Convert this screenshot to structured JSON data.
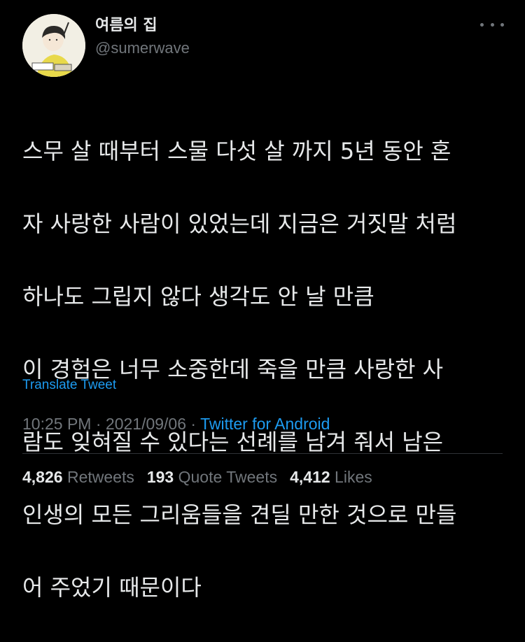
{
  "author": {
    "display_name": "여름의 집",
    "handle": "@sumerwave"
  },
  "tweet": {
    "lines": [
      "스무 살 때부터 스물 다섯 살 까지 5년 동안 혼",
      "자 사랑한 사람이 있었는데 지금은 거짓말 처럼",
      "하나도 그립지 않다 생각도 안 날 만큼",
      "이 경험은 너무 소중한데 죽을 만큼 사랑한 사",
      "람도 잊혀질 수 있다는 선례를 남겨 줘서 남은",
      "인생의 모든 그리움들을 견딜 만한 것으로 만들",
      "어 주었기 때문이다"
    ],
    "translate_label": "Translate Tweet",
    "time": "10:25 PM",
    "date": "2021/09/06",
    "separator": "·",
    "source": "Twitter for Android"
  },
  "stats": {
    "retweets_count": "4,826",
    "retweets_label": "Retweets",
    "quotes_count": "193",
    "quotes_label": "Quote Tweets",
    "likes_count": "4,412",
    "likes_label": "Likes"
  },
  "colors": {
    "background": "#000000",
    "text": "#e7e9ea",
    "secondary": "#71767b",
    "accent": "#1d9bf0"
  },
  "icons": {
    "more": "more-options-icon"
  }
}
